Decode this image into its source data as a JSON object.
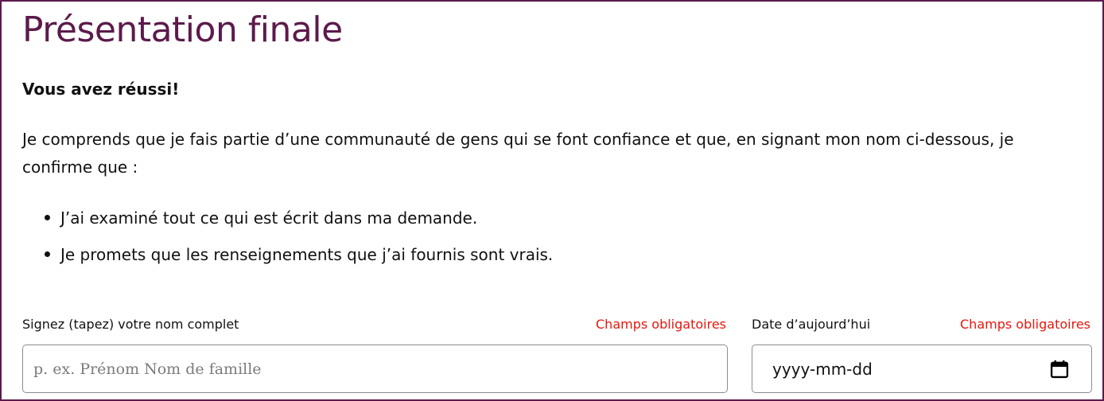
{
  "page": {
    "title": "Présentation finale",
    "subtitle": "Vous avez réussi!",
    "intro": "Je comprends que je fais partie d’une communauté de gens qui se font confiance et que, en signant mon nom ci-dessous, je confirme que :",
    "bullets": [
      "J’ai examiné tout ce qui est écrit dans ma demande.",
      "Je promets que les renseignements que j’ai fournis sont vrais."
    ]
  },
  "form": {
    "name_field": {
      "label": "Signez (tapez) votre nom complet",
      "required_text": "Champs obligatoires",
      "placeholder": "p. ex. Prénom Nom de famille",
      "value": ""
    },
    "date_field": {
      "label": "Date d’aujourd’hui",
      "required_text": "Champs obligatoires",
      "placeholder": "yyyy-mm-dd",
      "icon": "calendar-icon"
    }
  },
  "colors": {
    "accent": "#5c1a4b",
    "required": "#e8170c",
    "input_border": "#8c8c8c"
  }
}
